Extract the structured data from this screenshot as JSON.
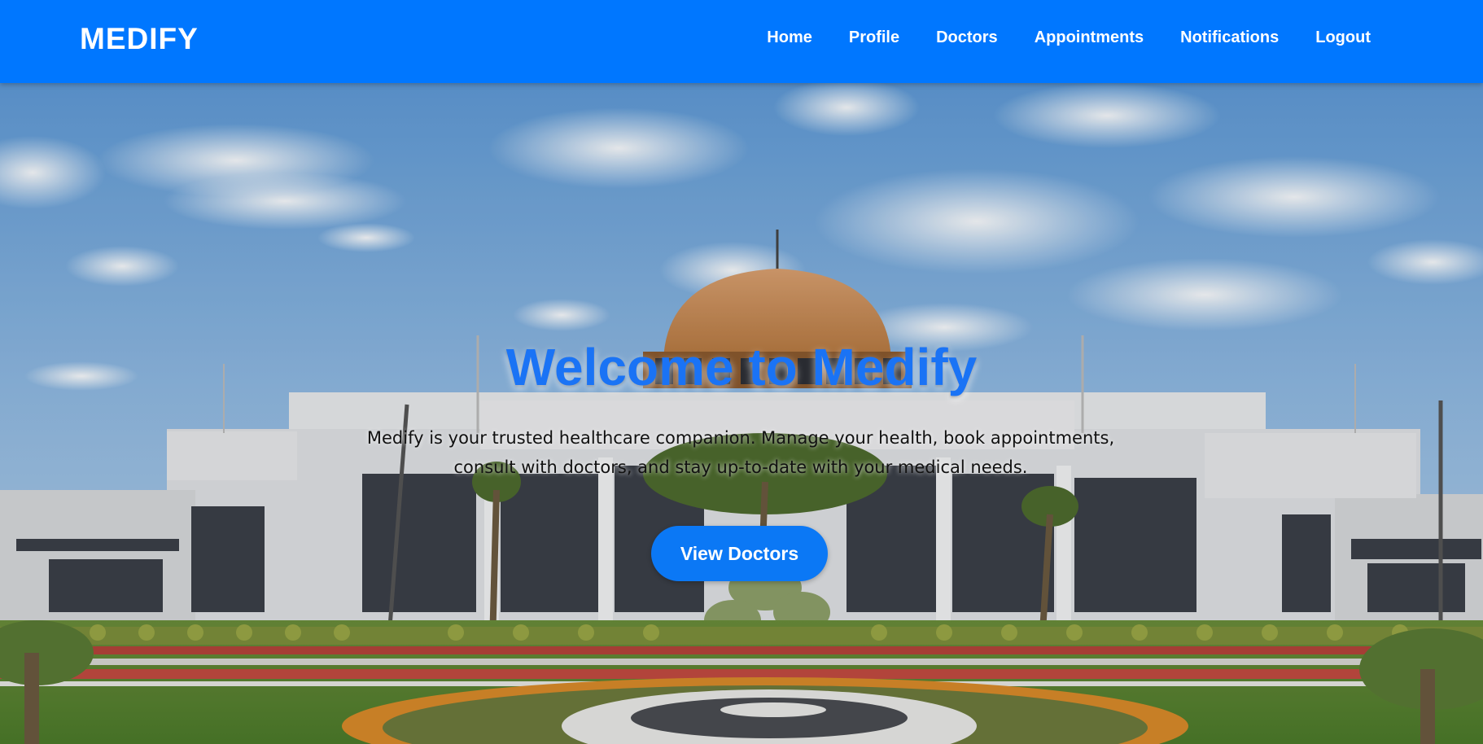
{
  "brand": "MEDIFY",
  "nav": {
    "items": [
      "Home",
      "Profile",
      "Doctors",
      "Appointments",
      "Notifications",
      "Logout"
    ]
  },
  "hero": {
    "title": "Welcome to Medify",
    "description": "Medify is your trusted healthcare companion. Manage your health, book appointments, consult with doctors, and stay up-to-date with your medical needs.",
    "button_label": "View Doctors"
  },
  "colors": {
    "navbar": "#0077ff",
    "title": "#1a73f5",
    "button": "#0b78f5"
  }
}
